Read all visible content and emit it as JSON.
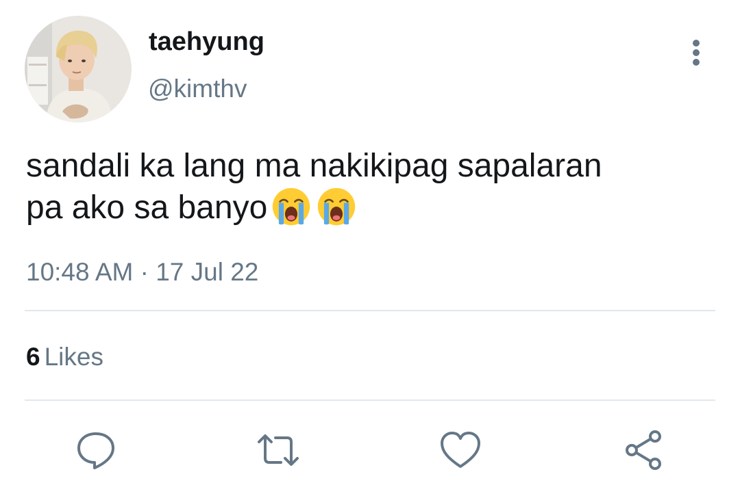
{
  "user": {
    "display_name": "taehyung",
    "handle": "@kimthv",
    "avatar": "profile-photo"
  },
  "tweet": {
    "text_line_1": "sandali ka lang ma nakikipag sapalaran",
    "text_line_2": "pa ako sa banyo",
    "emojis": [
      "loudly-crying-face",
      "loudly-crying-face"
    ],
    "timestamp": "10:48 AM · 17 Jul 22"
  },
  "stats": {
    "likes_count": "6",
    "likes_label": "Likes"
  },
  "actions": [
    "reply-icon",
    "retweet-icon",
    "like-icon",
    "share-icon"
  ],
  "colors": {
    "text_primary": "#14171a",
    "text_secondary": "#657786",
    "divider": "#e1e8ed",
    "emoji_face": "#ffcc33",
    "emoji_tears": "#5aa9e6"
  }
}
